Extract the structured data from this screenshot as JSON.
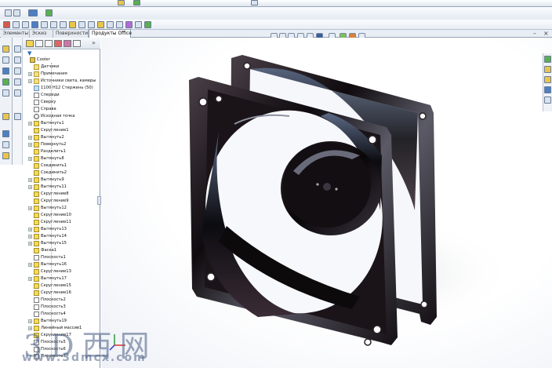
{
  "tabs": [
    "Элементы",
    "Эскиз",
    "Поверхности",
    "Продукты Office"
  ],
  "active_tab": 3,
  "window_controls": {
    "minimize": "–",
    "close": "×"
  },
  "tree": [
    {
      "label": "Cooler",
      "icon": "part",
      "pm": false
    },
    {
      "label": "Датчики",
      "icon": "fol",
      "pm": false
    },
    {
      "label": "Примечания",
      "icon": "fol",
      "pm": true
    },
    {
      "label": "Источники света, камеры",
      "icon": "fol",
      "pm": true
    },
    {
      "label": "1100 Н12 Стержень (50)",
      "icon": "gr",
      "pm": false
    },
    {
      "label": "Спереди",
      "icon": "pl",
      "pm": false
    },
    {
      "label": "Сверху",
      "icon": "pl",
      "pm": false
    },
    {
      "label": "Справа",
      "icon": "pl",
      "pm": false
    },
    {
      "label": "Исходная точка",
      "icon": "org",
      "pm": false
    },
    {
      "label": "Вытянуть1",
      "icon": "ft",
      "pm": true
    },
    {
      "label": "Скругление1",
      "icon": "ft",
      "pm": false
    },
    {
      "label": "Вытянуть2",
      "icon": "ft",
      "pm": true
    },
    {
      "label": "Повернуть2",
      "icon": "ft",
      "pm": true
    },
    {
      "label": "Разделить1",
      "icon": "ft",
      "pm": false
    },
    {
      "label": "Вытянуть8",
      "icon": "ft",
      "pm": true
    },
    {
      "label": "Соединить1",
      "icon": "ft",
      "pm": false
    },
    {
      "label": "Соединить2",
      "icon": "ft",
      "pm": false
    },
    {
      "label": "Вытянуть9",
      "icon": "ft",
      "pm": true
    },
    {
      "label": "Вытянуть11",
      "icon": "ft",
      "pm": true
    },
    {
      "label": "Скругление8",
      "icon": "ft",
      "pm": false
    },
    {
      "label": "Скругление9",
      "icon": "ft",
      "pm": false
    },
    {
      "label": "Вытянуть12",
      "icon": "ft",
      "pm": true
    },
    {
      "label": "Скругление10",
      "icon": "ft",
      "pm": false
    },
    {
      "label": "Скругление11",
      "icon": "ft",
      "pm": false
    },
    {
      "label": "Вытянуть13",
      "icon": "ft",
      "pm": true
    },
    {
      "label": "Вытянуть14",
      "icon": "ft",
      "pm": true
    },
    {
      "label": "Вытянуть15",
      "icon": "ft",
      "pm": true
    },
    {
      "label": "Фаска1",
      "icon": "ft",
      "pm": false
    },
    {
      "label": "Плоскость1",
      "icon": "pl",
      "pm": false
    },
    {
      "label": "Вытянуть16",
      "icon": "ft",
      "pm": true
    },
    {
      "label": "Скругление13",
      "icon": "ft",
      "pm": false
    },
    {
      "label": "Вытянуть17",
      "icon": "ft",
      "pm": true
    },
    {
      "label": "Скругление15",
      "icon": "ft",
      "pm": false
    },
    {
      "label": "Скругление16",
      "icon": "ft",
      "pm": false
    },
    {
      "label": "Плоскость2",
      "icon": "pl",
      "pm": false
    },
    {
      "label": "Плоскость3",
      "icon": "pl",
      "pm": false
    },
    {
      "label": "Плоскость4",
      "icon": "pl",
      "pm": false
    },
    {
      "label": "Вытянуть19",
      "icon": "ft",
      "pm": true
    },
    {
      "label": "Линейный массив1",
      "icon": "ft",
      "pm": true
    },
    {
      "label": "Скругление17",
      "icon": "ft",
      "pm": false
    },
    {
      "label": "Плоскость5",
      "icon": "pl",
      "pm": false
    },
    {
      "label": "Плоскость6",
      "icon": "pl",
      "pm": false
    },
    {
      "label": "Плоскость7",
      "icon": "pl",
      "pm": false
    }
  ],
  "watermark": {
    "chars": "3D西网",
    "url": "www.3dmcx.com"
  },
  "colors": {
    "accent": "#2a6bc2",
    "frame": "#1a1418",
    "panel_border": "#8f9cb0"
  }
}
